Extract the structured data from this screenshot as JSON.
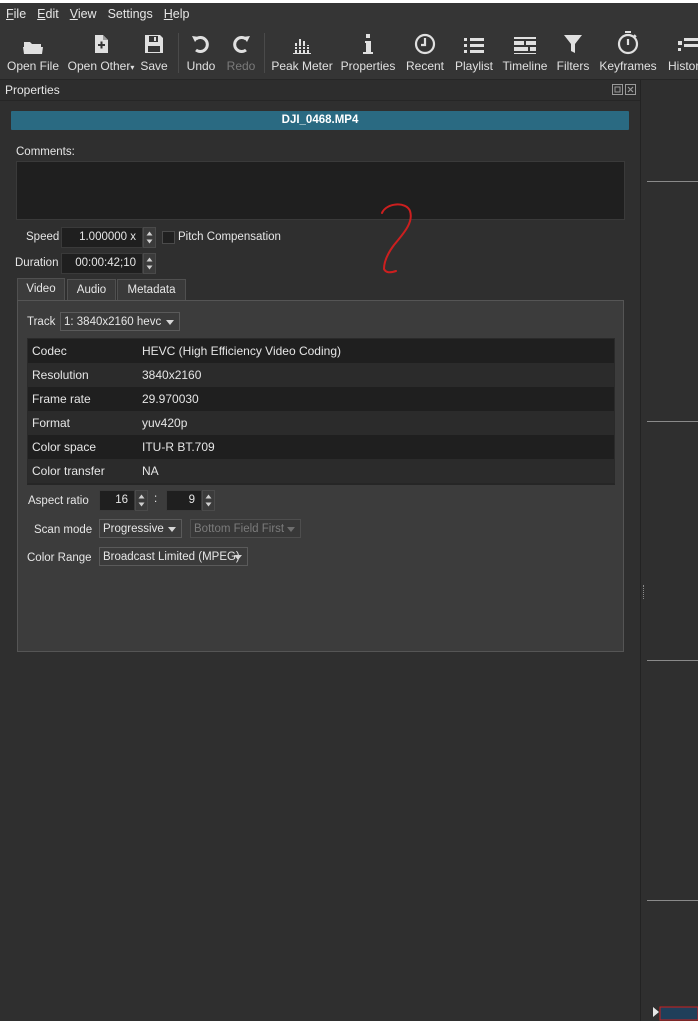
{
  "menu": {
    "file": "F",
    "file_rest": "ile",
    "edit": "E",
    "edit_rest": "dit",
    "view": "V",
    "view_rest": "iew",
    "settings": "Settings",
    "help": "H",
    "help_rest": "elp"
  },
  "toolbar": {
    "open_file": "Open File",
    "open_other": "Open Other",
    "save": "Save",
    "undo": "Undo",
    "redo": "Redo",
    "peak_meter": "Peak Meter",
    "properties": "Properties",
    "recent": "Recent",
    "playlist": "Playlist",
    "timeline": "Timeline",
    "filters": "Filters",
    "keyframes": "Keyframes",
    "history": "Histor"
  },
  "dock": {
    "title": "Properties"
  },
  "clip": {
    "filename": "DJI_0468.MP4",
    "comments_label": "Comments:",
    "comments_value": "",
    "speed_label": "Speed",
    "speed_value": "1.000000 x",
    "pitch_label": "Pitch Compensation",
    "pitch_checked": false,
    "duration_label": "Duration",
    "duration_value": "00:00:42;10"
  },
  "tabs": [
    "Video",
    "Audio",
    "Metadata"
  ],
  "active_tab": "Video",
  "video": {
    "track_label": "Track",
    "track_value": "1: 3840x2160 hevc",
    "info": [
      {
        "key": "Codec",
        "value": "HEVC (High Efficiency Video Coding)"
      },
      {
        "key": "Resolution",
        "value": "3840x2160"
      },
      {
        "key": "Frame rate",
        "value": "29.970030"
      },
      {
        "key": "Format",
        "value": "yuv420p"
      },
      {
        "key": "Color space",
        "value": "ITU-R BT.709"
      },
      {
        "key": "Color transfer",
        "value": "NA"
      }
    ],
    "aspect_label": "Aspect ratio",
    "aspect_w": "16",
    "aspect_sep": ":",
    "aspect_h": "9",
    "scan_label": "Scan mode",
    "scan_value": "Progressive",
    "field_value": "Bottom Field First",
    "range_label": "Color Range",
    "range_value": "Broadcast Limited (MPEG)"
  },
  "colors": {
    "accent": "#2a6a82",
    "annotation": "#cc1f1f",
    "panel_bg": "#2f2f2f",
    "tab_bg": "#3c3c3c"
  }
}
